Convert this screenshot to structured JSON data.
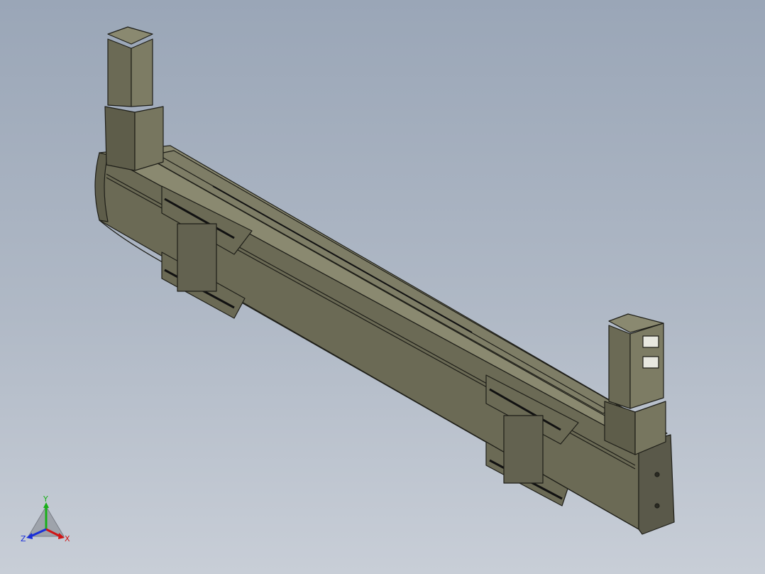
{
  "viewport": {
    "background_top": "#9aa6b7",
    "background_bottom": "#c8ced7"
  },
  "model": {
    "body_color": "#6b6a55",
    "body_dark": "#4e4d3d",
    "body_light": "#8a8970",
    "edge_color": "#1e1e18"
  },
  "triad": {
    "x_label": "X",
    "y_label": "Y",
    "z_label": "Z",
    "x_color": "#d01515",
    "y_color": "#18b018",
    "z_color": "#1a2fd8"
  }
}
